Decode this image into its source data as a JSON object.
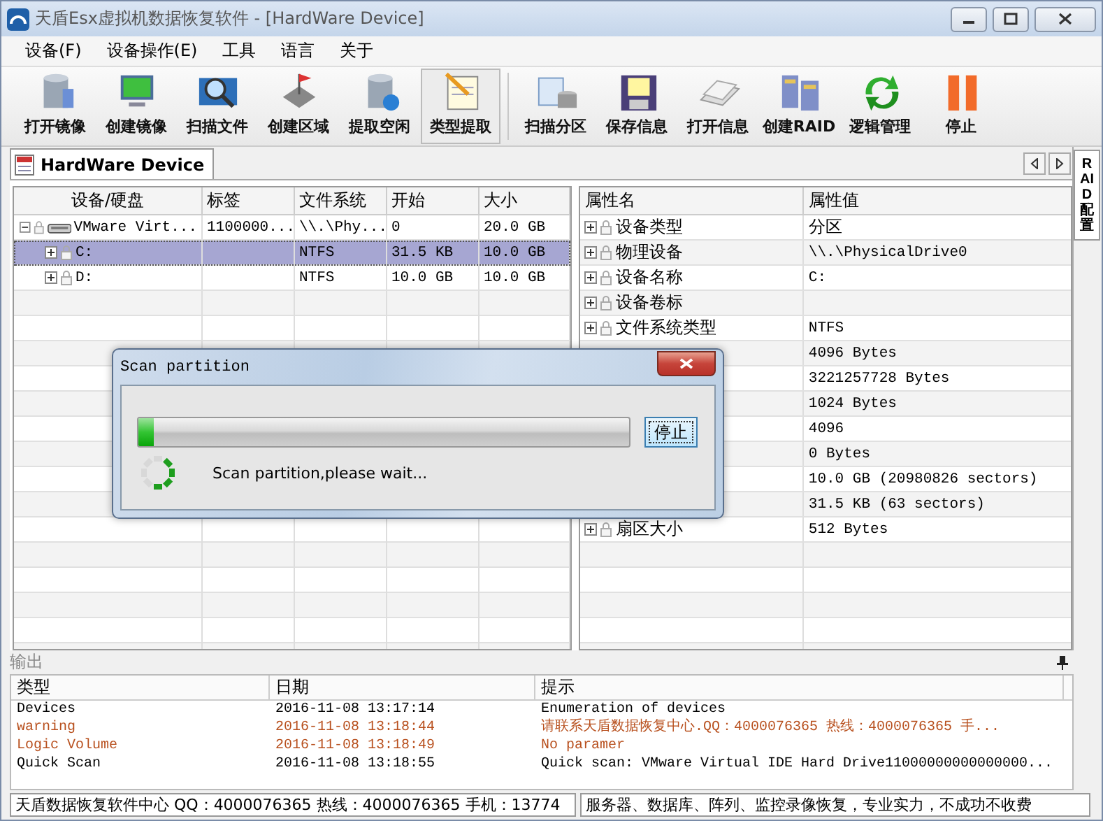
{
  "window": {
    "title": "天盾Esx虚拟机数据恢复软件 - [HardWare Device]"
  },
  "menu": [
    "设备(F)",
    "设备操作(E)",
    "工具",
    "语言",
    "关于"
  ],
  "toolbar": [
    {
      "label": "打开镜像",
      "selected": false
    },
    {
      "label": "创建镜像",
      "selected": false
    },
    {
      "label": "扫描文件",
      "selected": false
    },
    {
      "label": "创建区域",
      "selected": false
    },
    {
      "label": "提取空闲",
      "selected": false
    },
    {
      "label": "类型提取",
      "selected": true
    },
    {
      "label": "扫描分区",
      "selected": false
    },
    {
      "label": "保存信息",
      "selected": false
    },
    {
      "label": "打开信息",
      "selected": false
    },
    {
      "label": "创建RAID",
      "selected": false
    },
    {
      "label": "逻辑管理",
      "selected": false
    },
    {
      "label": "停止",
      "selected": false
    }
  ],
  "tabs": [
    {
      "label": "HardWare Device",
      "selected": true
    }
  ],
  "side_tab": "RAID配置",
  "device_table": {
    "columns": [
      "设备/硬盘",
      "标签",
      "文件系统",
      "开始",
      "大小"
    ],
    "rows": [
      {
        "kind": "disk",
        "name": "VMware Virt...",
        "label": "1100000...",
        "file_system": "\\\\.\\Phy...",
        "start": "0",
        "size": "20.0 GB",
        "expanded": true,
        "selected": false,
        "children": [
          {
            "kind": "partition",
            "name": "C:",
            "file_system": "NTFS",
            "start": "31.5 KB",
            "size": "10.0 GB",
            "expanded": false,
            "selected": true
          },
          {
            "kind": "partition",
            "name": "D:",
            "file_system": "NTFS",
            "start": "10.0 GB",
            "size": "10.0 GB",
            "expanded": false,
            "selected": false
          }
        ]
      }
    ]
  },
  "property_table": {
    "columns": [
      "属性名",
      "属性值"
    ],
    "rows": [
      {
        "name": "设备类型",
        "value": "分区"
      },
      {
        "name": "物理设备",
        "value": "\\\\.\\PhysicalDrive0"
      },
      {
        "name": "设备名称",
        "value": "C:"
      },
      {
        "name": "设备卷标"
      },
      {
        "name": "文件系统类型",
        "value": "NTFS"
      },
      {
        "value": "4096 Bytes"
      },
      {
        "value": "3221257728 Bytes"
      },
      {
        "value": "1024 Bytes"
      },
      {
        "value": "4096"
      },
      {
        "value": "0 Bytes"
      },
      {
        "value": "10.0 GB (20980826 sectors)"
      },
      {
        "value": "31.5 KB (63 sectors)"
      },
      {
        "name": "扇区大小",
        "value": "512 Bytes"
      }
    ]
  },
  "output": {
    "title": "输出",
    "columns": [
      "类型",
      "日期",
      "提示"
    ],
    "rows": [
      {
        "type": "Devices",
        "date": "2016-11-08 13:17:14",
        "message": "Enumeration of devices",
        "color": "#000000"
      },
      {
        "type": "warning",
        "date": "2016-11-08 13:18:44",
        "message": "请联系天盾数据恢复中心.QQ：4000076365 热线：4000076365 手...",
        "color": "#b8501e"
      },
      {
        "type": "Logic Volume",
        "date": "2016-11-08 13:18:49",
        "message": "No paramer",
        "color": "#b8501e"
      },
      {
        "type": "Quick Scan",
        "date": "2016-11-08 13:18:55",
        "message": "Quick scan: VMware Virtual IDE Hard Drive11000000000000000...",
        "color": "#000000"
      }
    ]
  },
  "status_bar": [
    "天盾数据恢复软件中心 QQ：4000076365 热线：4000076365 手机：13774",
    "服务器、数据库、阵列、监控录像恢复，专业实力，不成功不收费"
  ],
  "dialog": {
    "title": "Scan partition",
    "progress": {
      "level": 0.03
    },
    "button": "停止",
    "message": "Scan partition,please wait..."
  }
}
